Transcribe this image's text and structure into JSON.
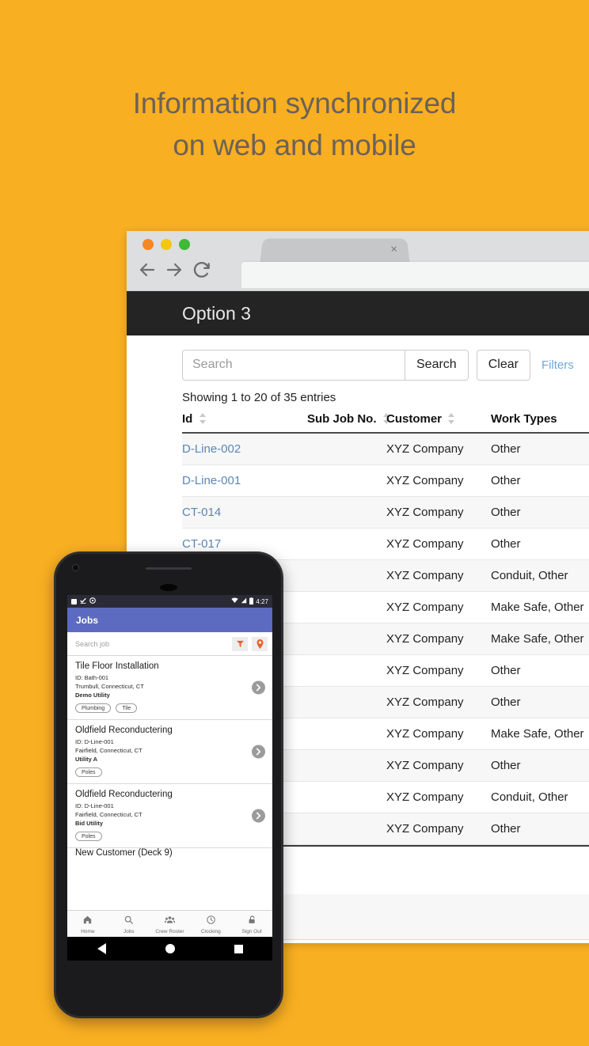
{
  "background_color": "#F9AF22",
  "headline": {
    "line1": "Information synchronized",
    "line2": "on web and mobile",
    "color": "#6B6258"
  },
  "browser": {
    "tab": {
      "close_label": "×"
    },
    "address_bar": {
      "value": "",
      "placeholder": ""
    },
    "nav": {
      "back_icon": "arrow-left-icon",
      "forward_icon": "arrow-right-icon",
      "reload_icon": "reload-icon"
    },
    "traffic_lights": [
      "#F6861F",
      "#F2C80F",
      "#3FB936"
    ],
    "app_title": "Option 3",
    "toolbar": {
      "search_placeholder": "Search",
      "search_value": "",
      "search_button": "Search",
      "clear_button": "Clear",
      "filters_link": "Filters",
      "filters_color": "#6FA8DC"
    },
    "showing_text": "Showing 1 to 20 of 35 entries",
    "table": {
      "columns": [
        "Id",
        "Sub Job No.",
        "Customer",
        "Work Types"
      ],
      "link_color": "#5B86B5",
      "rows": [
        {
          "id": "D-Line-002",
          "sub_job_no": "",
          "customer": "XYZ Company",
          "work_types": "Other"
        },
        {
          "id": "D-Line-001",
          "sub_job_no": "",
          "customer": "XYZ Company",
          "work_types": "Other"
        },
        {
          "id": "CT-014",
          "sub_job_no": "",
          "customer": "XYZ Company",
          "work_types": "Other"
        },
        {
          "id": "CT-017",
          "sub_job_no": "",
          "customer": "XYZ Company",
          "work_types": "Other"
        },
        {
          "id": "",
          "sub_job_no": "",
          "customer": "XYZ Company",
          "work_types": "Conduit, Other"
        },
        {
          "id": "",
          "sub_job_no": "",
          "customer": "XYZ Company",
          "work_types": "Make Safe, Other"
        },
        {
          "id": "",
          "sub_job_no": "",
          "customer": "XYZ Company",
          "work_types": "Make Safe, Other"
        },
        {
          "id": "",
          "sub_job_no": "",
          "customer": "XYZ Company",
          "work_types": "Other"
        },
        {
          "id": "",
          "sub_job_no": "",
          "customer": "XYZ Company",
          "work_types": "Other"
        },
        {
          "id": "",
          "sub_job_no": "",
          "customer": "XYZ Company",
          "work_types": "Make Safe, Other"
        },
        {
          "id": "",
          "sub_job_no": "",
          "customer": "XYZ Company",
          "work_types": "Other"
        },
        {
          "id": "",
          "sub_job_no": "",
          "customer": "XYZ Company",
          "work_types": "Conduit, Other"
        },
        {
          "id": "",
          "sub_job_no": "",
          "customer": "XYZ Company",
          "work_types": "Other"
        }
      ]
    }
  },
  "phone": {
    "status_bar": {
      "time": "4:27",
      "icons": [
        "app-icon",
        "check-icon",
        "circle-icon",
        "wifi-icon",
        "signal-icon",
        "battery-icon"
      ]
    },
    "app_title": "Jobs",
    "search": {
      "placeholder": "Search job",
      "value": "",
      "filter_icon": "filter-funnel-icon",
      "map_icon": "map-pin-icon",
      "icon_color": "#E8602C"
    },
    "jobs": [
      {
        "title": "Tile Floor Installation",
        "id_line": "ID: Bath-001",
        "location": "Trumbull, Connecticut, CT",
        "utility": "Demo Utility",
        "tags": [
          "Plumbing",
          "Tile"
        ]
      },
      {
        "title": "Oldfield Reconductering",
        "id_line": "ID: D-Line-001",
        "location": "Fairfield, Connecticut, CT",
        "utility": "Utility A",
        "tags": [
          "Poles"
        ]
      },
      {
        "title": "Oldfield Reconductering",
        "id_line": "ID: D-Line-001",
        "location": "Fairfield, Connecticut, CT",
        "utility": "Bid Utility",
        "tags": [
          "Poles"
        ]
      }
    ],
    "partial_job_title": "New Customer (Deck 9)",
    "bottom_nav": [
      {
        "label": "Home",
        "icon": "home-icon"
      },
      {
        "label": "Jobs",
        "icon": "search-icon"
      },
      {
        "label": "Crew Roster",
        "icon": "people-icon"
      },
      {
        "label": "Clocking",
        "icon": "clock-icon"
      },
      {
        "label": "Sign Out",
        "icon": "unlock-icon"
      }
    ],
    "android_nav": {
      "back": "back-triangle-icon",
      "home": "home-circle-icon",
      "recents": "recents-square-icon"
    }
  }
}
